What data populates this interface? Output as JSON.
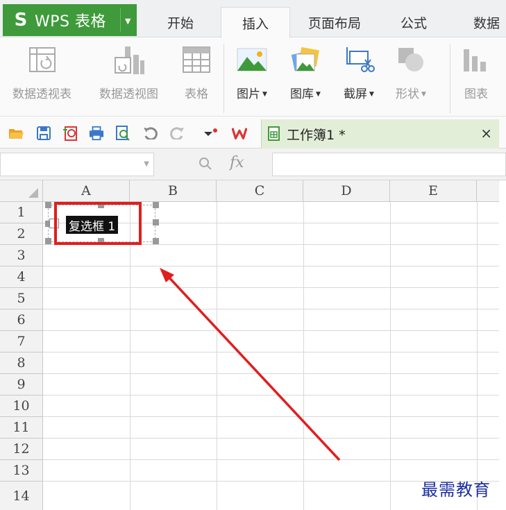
{
  "app": {
    "name": "WPS 表格",
    "logo_letter": "S"
  },
  "tabs": [
    {
      "label": "开始",
      "active": false
    },
    {
      "label": "插入",
      "active": true
    },
    {
      "label": "页面布局",
      "active": false
    },
    {
      "label": "公式",
      "active": false
    },
    {
      "label": "数据",
      "active": false
    }
  ],
  "ribbon": {
    "pivot_table": "数据透视表",
    "pivot_chart": "数据透视图",
    "table": "表格",
    "picture": "图片",
    "gallery": "图库",
    "screenshot": "截屏",
    "shape": "形状",
    "chart": "图表"
  },
  "doc_tab": {
    "title": "工作簿1 *",
    "close": "×"
  },
  "formula_bar": {
    "fx": "fx",
    "name_box": "",
    "formula": ""
  },
  "columns": [
    "A",
    "B",
    "C",
    "D",
    "E"
  ],
  "rows": [
    "1",
    "2",
    "3",
    "4",
    "5",
    "6",
    "7",
    "8",
    "9",
    "10",
    "11",
    "12",
    "13",
    "14"
  ],
  "checkbox_control": {
    "label": "复选框 1",
    "checked": false
  },
  "watermark": "最需教育",
  "colors": {
    "app_green": "#3e9a3a",
    "doc_tab_green": "#e3eed8",
    "annotation_red": "#e21d1d",
    "watermark_blue": "#1c2f9e"
  }
}
